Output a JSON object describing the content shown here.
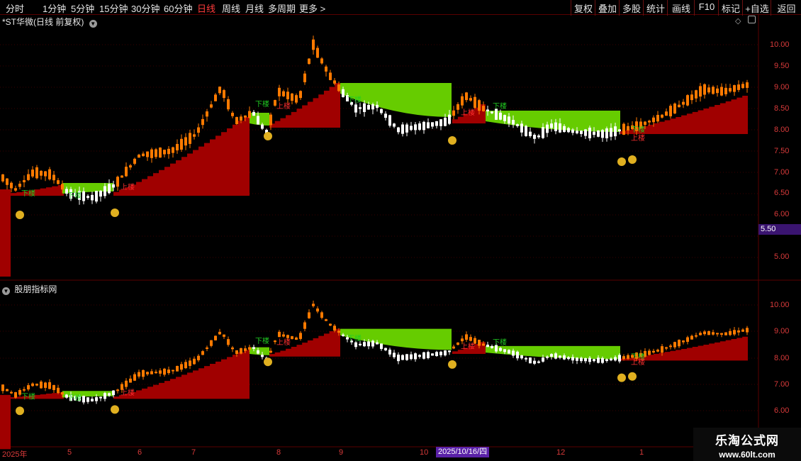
{
  "toolbar": {
    "periods": [
      "分时",
      "1分钟",
      "5分钟",
      "15分钟",
      "30分钟",
      "60分钟",
      "日线",
      "周线",
      "月线",
      "多周期",
      "更多 >"
    ],
    "active_period": "日线",
    "right_buttons": [
      "复权",
      "叠加",
      "多股",
      "统计",
      "画线",
      "F10",
      "标记",
      "+自选",
      "返回"
    ]
  },
  "main_panel": {
    "title": "*ST华微(日线 前复权)"
  },
  "sub_panel": {
    "title": "股朋指标网"
  },
  "price_tag": "5.50",
  "main_axis": [
    "10.00",
    "9.50",
    "9.00",
    "8.50",
    "8.00",
    "7.50",
    "7.00",
    "6.50",
    "6.00",
    "5.50",
    "5.00"
  ],
  "sub_axis": [
    "10.00",
    "9.00",
    "8.00",
    "7.00",
    "6.00"
  ],
  "date_axis": [
    "2025年",
    "5",
    "6",
    "7",
    "8",
    "9",
    "10",
    "12",
    "1"
  ],
  "highlight_date": "2025/10/16/四",
  "signal_labels": {
    "up": "上楼",
    "down": "下楼"
  },
  "logo": {
    "line1": "乐淘公式网",
    "line2": "www.60lt.com"
  },
  "colors": {
    "up": "#ff7a00",
    "down": "#ffffff",
    "red_area": "#a00000",
    "green_area": "#66cc00",
    "axis": "#d93a3a",
    "grid": "#5a0000"
  }
}
